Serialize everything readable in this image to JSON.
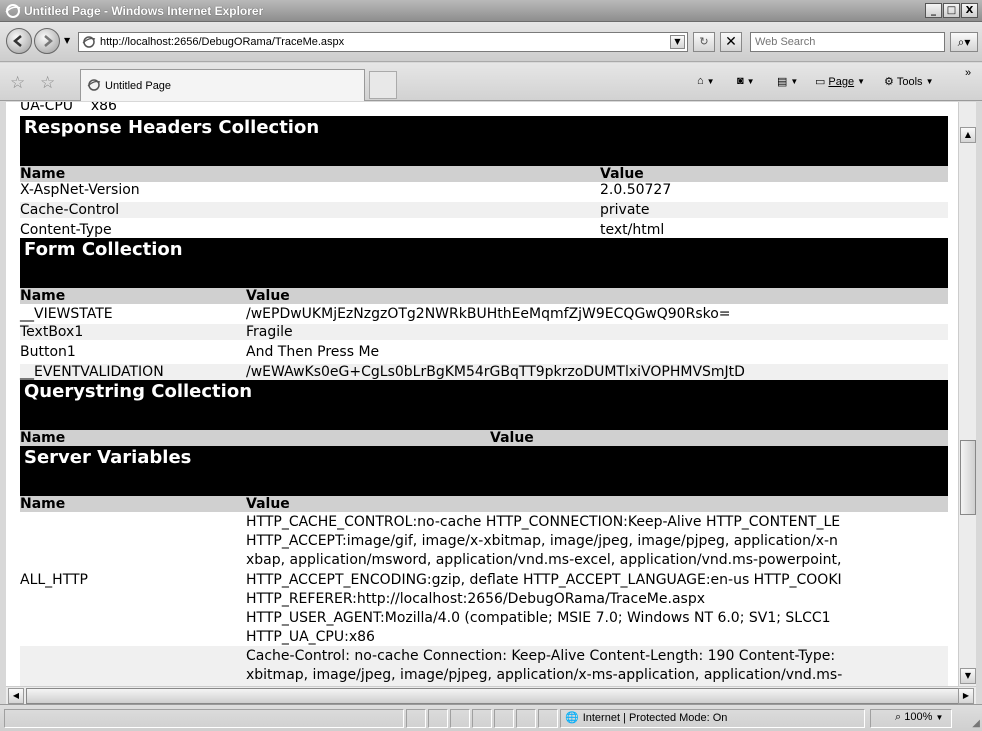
{
  "window": {
    "title": "Untitled Page - Windows Internet Explorer",
    "buttons": [
      "_",
      "□",
      "X"
    ]
  },
  "address": {
    "url": "http://localhost:2656/DebugORama/TraceMe.aspx",
    "search_placeholder": "Web Search"
  },
  "tab": {
    "label": "Untitled Page"
  },
  "commands": {
    "page": "Page",
    "tools": "Tools"
  },
  "trace": {
    "ua_cpu": "UA-CPU    x86",
    "response_headers": {
      "title": "Response Headers Collection",
      "col_name": "Name",
      "col_value": "Value",
      "rows": [
        {
          "name": "X-AspNet-Version",
          "value": "2.0.50727"
        },
        {
          "name": "Cache-Control",
          "value": "private"
        },
        {
          "name": "Content-Type",
          "value": "text/html"
        }
      ]
    },
    "form": {
      "title": "Form Collection",
      "col_name": "Name",
      "col_value": "Value",
      "rows": [
        {
          "name": "__VIEWSTATE",
          "value": "/wEPDwUKMjEzNzgzOTg2NWRkBUHthEeMqmfZjW9ECQGwQ90Rsko="
        },
        {
          "name": "TextBox1",
          "value": "Fragile"
        },
        {
          "name": "Button1",
          "value": "And Then Press Me"
        },
        {
          "name": "__EVENTVALIDATION",
          "value": "/wEWAwKs0eG+CgLs0bLrBgKM54rGBqTT9pkrzoDUMTlxiVOPHMVSmJtD"
        }
      ]
    },
    "querystring": {
      "title": "Querystring Collection",
      "col_name": "Name",
      "col_value": "Value"
    },
    "server_vars": {
      "title": "Server Variables",
      "col_name": "Name",
      "col_value": "Value",
      "all_http_name": "ALL_HTTP",
      "all_http_lines": [
        "HTTP_CACHE_CONTROL:no-cache HTTP_CONNECTION:Keep-Alive HTTP_CONTENT_LE",
        "HTTP_ACCEPT:image/gif, image/x-xbitmap, image/jpeg, image/pjpeg, application/x-n",
        "xbap, application/msword, application/vnd.ms-excel, application/vnd.ms-powerpoint,",
        "HTTP_ACCEPT_ENCODING:gzip, deflate HTTP_ACCEPT_LANGUAGE:en-us HTTP_COOKI",
        "HTTP_REFERER:http://localhost:2656/DebugORama/TraceMe.aspx",
        "HTTP_USER_AGENT:Mozilla/4.0 (compatible; MSIE 7.0; Windows NT 6.0; SV1; SLCC1",
        "HTTP_UA_CPU:x86"
      ],
      "all_raw_lines": [
        "Cache-Control: no-cache Connection: Keep-Alive Content-Length: 190 Content-Type:",
        "xbitmap, image/jpeg, image/pjpeg, application/x-ms-application, application/vnd.ms-"
      ]
    }
  },
  "status": {
    "zone": "Internet | Protected Mode: On",
    "zoom": "100%"
  }
}
